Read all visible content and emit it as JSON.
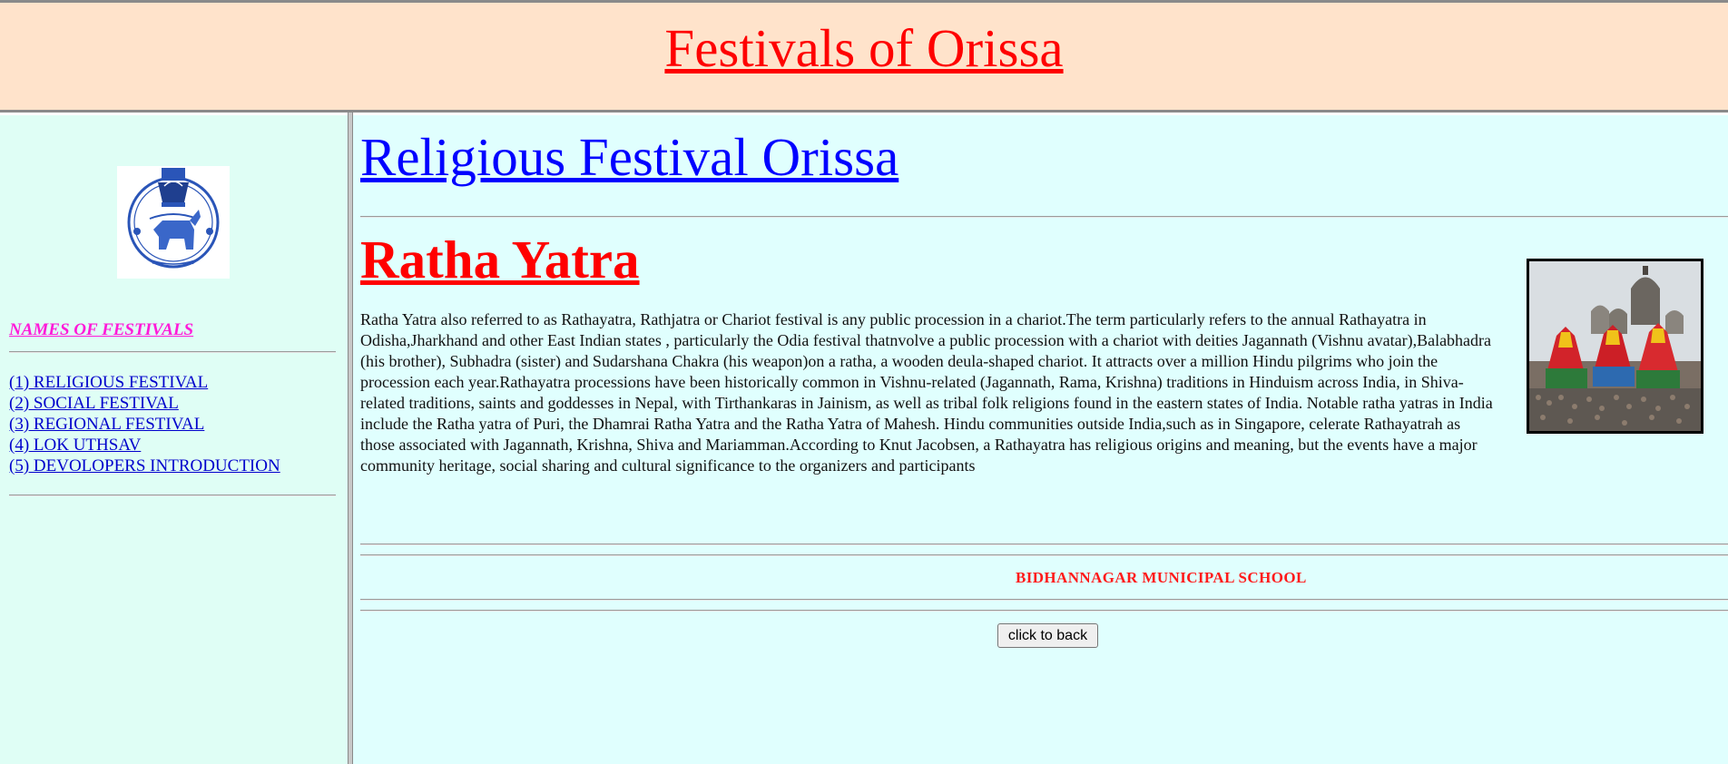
{
  "header": {
    "title": "Festivals of Orissa"
  },
  "sidebar": {
    "heading": "NAMES OF FESTIVALS",
    "items": [
      {
        "label": "(1) RELIGIOUS FESTIVAL"
      },
      {
        "label": "(2) SOCIAL FESTIVAL"
      },
      {
        "label": "(3) REGIONAL FESTIVAL"
      },
      {
        "label": "(4) LOK UTHSAV"
      },
      {
        "label": "(5) DEVOLOPERS INTRODUCTION"
      }
    ]
  },
  "main": {
    "page_heading": "Religious Festival Orissa",
    "festival_title": "Ratha Yatra",
    "description": "Ratha Yatra also referred to as Rathayatra, Rathjatra or Chariot festival is any public procession in a chariot.The term particularly refers to the annual Rathayatra in Odisha,Jharkhand and other East Indian states , particularly the Odia festival thatnvolve a public procession with a chariot with deities Jagannath (Vishnu avatar),Balabhadra (his brother), Subhadra (sister) and Sudarshana Chakra (his weapon)on a ratha, a wooden deula-shaped chariot. It attracts over a million Hindu pilgrims who join the procession each year.Rathayatra processions have been historically common in Vishnu-related (Jagannath, Rama, Krishna) traditions in Hinduism across India, in Shiva-related traditions, saints and goddesses in Nepal, with Tirthankaras in Jainism, as well as tribal folk religions found in the eastern states of India. Notable ratha yatras in India include the Ratha yatra of Puri, the Dhamrai Ratha Yatra and the Ratha Yatra of Mahesh. Hindu communities outside India,such as in Singapore, celerate Rathayatrah as those associated with Jagannath, Krishna, Shiva and Mariamman.According to Knut Jacobsen, a Rathayatra has religious origins and meaning, but the events have a major community heritage, social sharing and cultural significance to the organizers and participants",
    "school_name": "BIDHANNAGAR MUNICIPAL SCHOOL",
    "back_button_label": "click to back"
  },
  "colors": {
    "header_bg": "#ffe3cb",
    "title_red": "#ff0000",
    "link_blue": "#0000ff",
    "sidebar_heading_pink": "#ff1ad9",
    "frame_bg": "#e0fffe"
  },
  "icons": {
    "emblem": "odisha-state-emblem-icon",
    "photo": "rath-yatra-chariot-photo"
  }
}
